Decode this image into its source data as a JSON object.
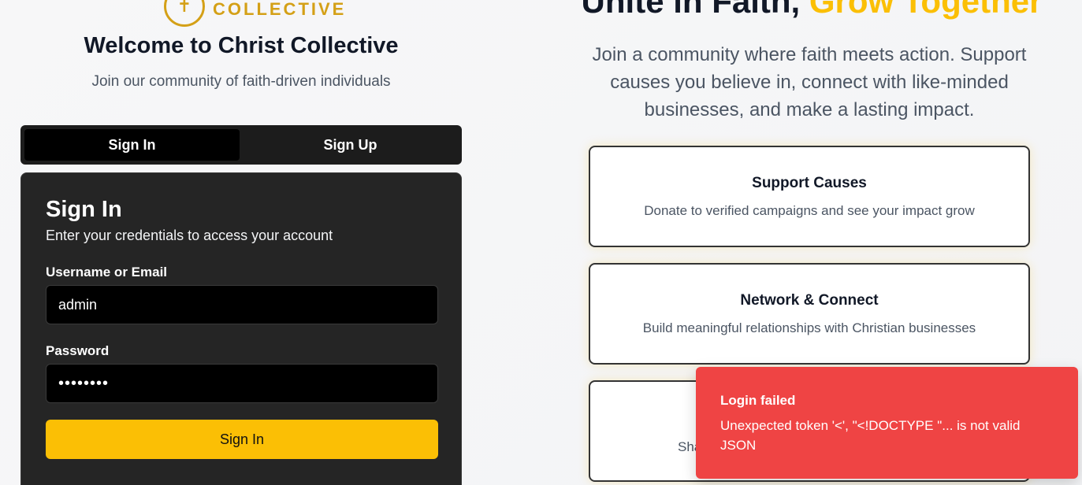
{
  "logo": {
    "text": "COLLECTIVE",
    "icon": "cross-icon"
  },
  "welcome": {
    "title": "Welcome to Christ Collective",
    "subtitle": "Join our community of faith-driven individuals"
  },
  "tabs": [
    {
      "label": "Sign In",
      "active": true
    },
    {
      "label": "Sign Up",
      "active": false
    }
  ],
  "signin_card": {
    "title": "Sign In",
    "description": "Enter your credentials to access your account",
    "username_label": "Username or Email",
    "username_value": "admin",
    "password_label": "Password",
    "password_value": "••••••••",
    "submit_label": "Sign In"
  },
  "hero": {
    "title_part1": "Unite in Faith, ",
    "title_accent": "Grow Together",
    "description": "Join a community where faith meets action. Support causes you believe in, connect with like-minded businesses, and make a lasting impact."
  },
  "features": [
    {
      "title": "Support Causes",
      "description": "Donate to verified campaigns and see your impact grow"
    },
    {
      "title": "Network & Connect",
      "description": "Build meaningful relationships with Christian businesses"
    },
    {
      "title": "",
      "description": "Sha"
    }
  ],
  "toast": {
    "title": "Login failed",
    "message": "Unexpected token '<', \"<!DOCTYPE \"... is not valid JSON"
  },
  "colors": {
    "accent": "#fbbf05",
    "card_bg": "#252525",
    "toast_bg": "#ef4444"
  }
}
